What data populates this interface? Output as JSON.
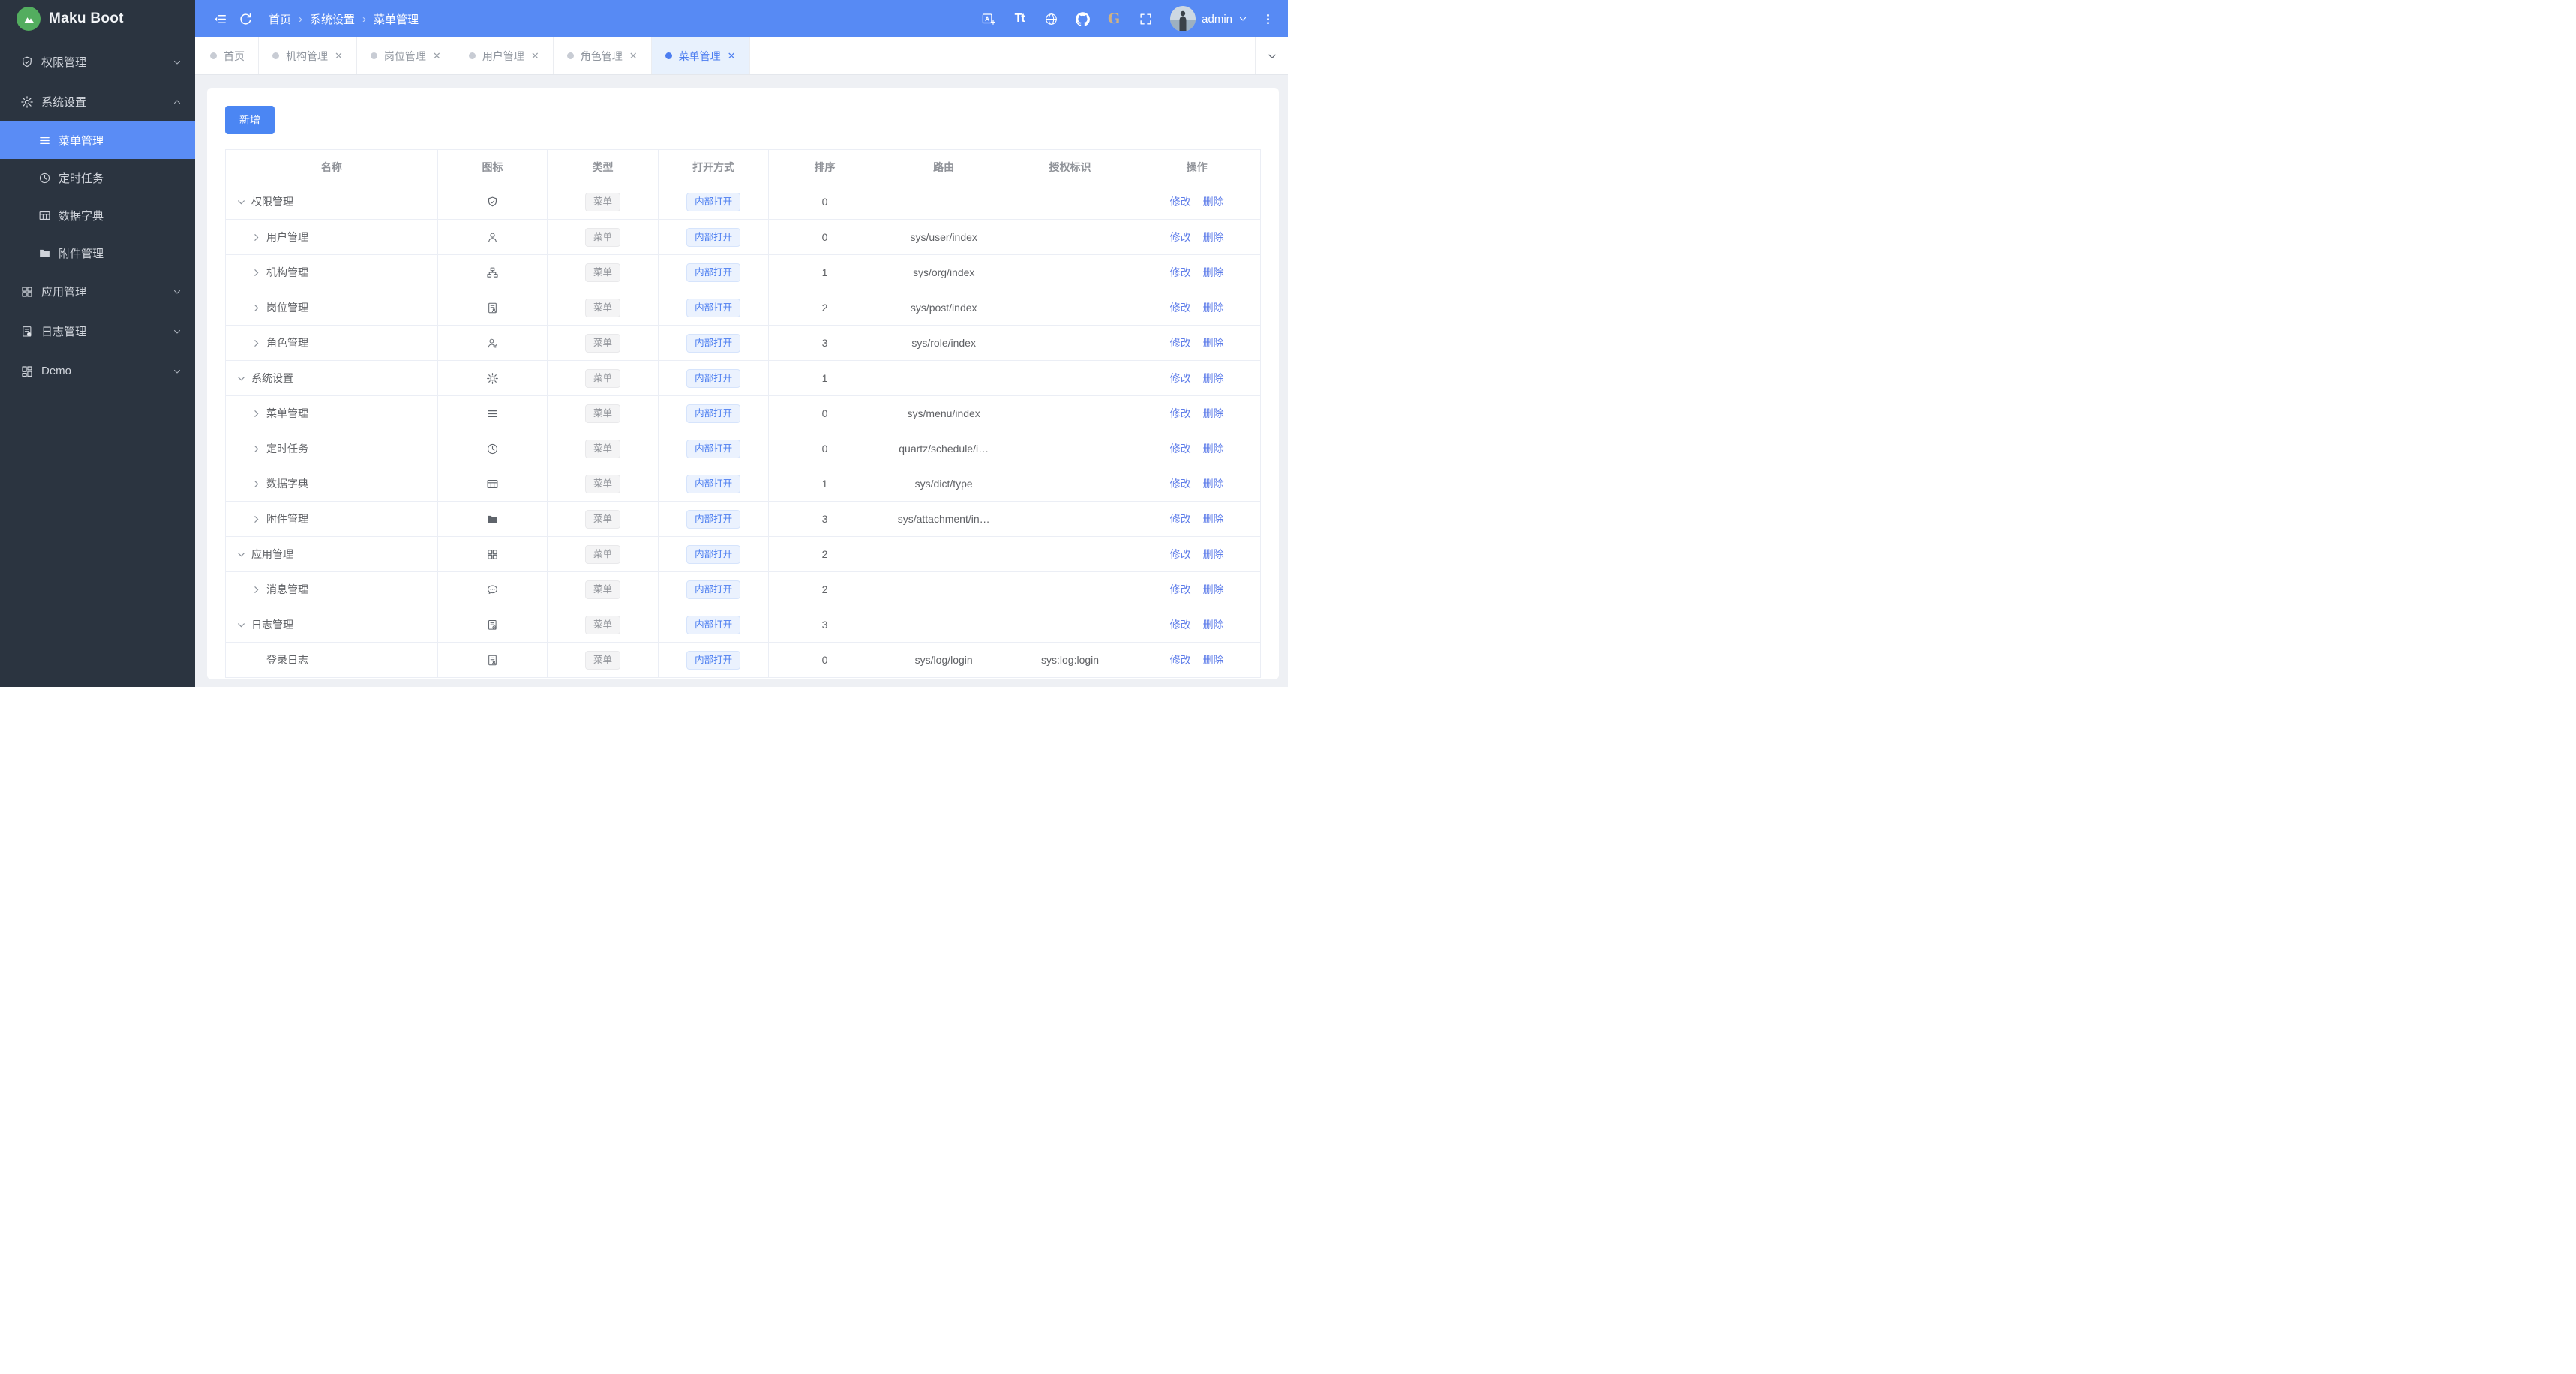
{
  "app": {
    "title": "Maku Boot"
  },
  "colors": {
    "primary": "#4c7df0",
    "header_bg": "#578af4",
    "sidebar_bg": "#2b3440",
    "sidebar_active": "#5a8cf5",
    "gitee_gold": "#cfb184"
  },
  "header": {
    "breadcrumb": [
      "首页",
      "系统设置",
      "菜单管理"
    ],
    "tool_icons": [
      "translate",
      "font-size",
      "globe",
      "github",
      "gitee",
      "fullscreen"
    ],
    "user": "admin"
  },
  "tabs": [
    {
      "label": "首页",
      "closable": false,
      "active": false
    },
    {
      "label": "机构管理",
      "closable": true,
      "active": false
    },
    {
      "label": "岗位管理",
      "closable": true,
      "active": false
    },
    {
      "label": "用户管理",
      "closable": true,
      "active": false
    },
    {
      "label": "角色管理",
      "closable": true,
      "active": false
    },
    {
      "label": "菜单管理",
      "closable": true,
      "active": true
    }
  ],
  "sidebar": {
    "items": [
      {
        "label": "权限管理",
        "icon": "shield-check",
        "expanded": false
      },
      {
        "label": "系统设置",
        "icon": "gear",
        "expanded": true,
        "children": [
          {
            "label": "菜单管理",
            "icon": "menu",
            "active": true
          },
          {
            "label": "定时任务",
            "icon": "clock",
            "active": false
          },
          {
            "label": "数据字典",
            "icon": "dict",
            "active": false
          },
          {
            "label": "附件管理",
            "icon": "folder",
            "active": false
          }
        ]
      },
      {
        "label": "应用管理",
        "icon": "grid",
        "expanded": false
      },
      {
        "label": "日志管理",
        "icon": "log",
        "expanded": false
      },
      {
        "label": "Demo",
        "icon": "grid-alt",
        "expanded": false
      }
    ]
  },
  "toolbar": {
    "add_label": "新增"
  },
  "table": {
    "columns": [
      "名称",
      "图标",
      "类型",
      "打开方式",
      "排序",
      "路由",
      "授权标识",
      "操作"
    ],
    "col_widths": [
      20.5,
      10.6,
      10.7,
      10.7,
      10.8,
      12.2,
      12.2,
      12.3
    ],
    "actions": [
      "修改",
      "删除"
    ],
    "rows": [
      {
        "name": "权限管理",
        "icon": "shield-check",
        "arrow": "down",
        "level": 0,
        "type": "菜单",
        "open": "内部打开",
        "sort": "0",
        "route": "",
        "auth": ""
      },
      {
        "name": "用户管理",
        "icon": "user",
        "arrow": "right",
        "level": 1,
        "type": "菜单",
        "open": "内部打开",
        "sort": "0",
        "route": "sys/user/index",
        "auth": ""
      },
      {
        "name": "机构管理",
        "icon": "org",
        "arrow": "right",
        "level": 1,
        "type": "菜单",
        "open": "内部打开",
        "sort": "1",
        "route": "sys/org/index",
        "auth": ""
      },
      {
        "name": "岗位管理",
        "icon": "idcard",
        "arrow": "right",
        "level": 1,
        "type": "菜单",
        "open": "内部打开",
        "sort": "2",
        "route": "sys/post/index",
        "auth": ""
      },
      {
        "name": "角色管理",
        "icon": "role",
        "arrow": "right",
        "level": 1,
        "type": "菜单",
        "open": "内部打开",
        "sort": "3",
        "route": "sys/role/index",
        "auth": ""
      },
      {
        "name": "系统设置",
        "icon": "gear",
        "arrow": "down",
        "level": 0,
        "type": "菜单",
        "open": "内部打开",
        "sort": "1",
        "route": "",
        "auth": ""
      },
      {
        "name": "菜单管理",
        "icon": "menu",
        "arrow": "right",
        "level": 1,
        "type": "菜单",
        "open": "内部打开",
        "sort": "0",
        "route": "sys/menu/index",
        "auth": ""
      },
      {
        "name": "定时任务",
        "icon": "clock",
        "arrow": "right",
        "level": 1,
        "type": "菜单",
        "open": "内部打开",
        "sort": "0",
        "route": "quartz/schedule/i…",
        "auth": ""
      },
      {
        "name": "数据字典",
        "icon": "dict",
        "arrow": "right",
        "level": 1,
        "type": "菜单",
        "open": "内部打开",
        "sort": "1",
        "route": "sys/dict/type",
        "auth": ""
      },
      {
        "name": "附件管理",
        "icon": "folder",
        "arrow": "right",
        "level": 1,
        "type": "菜单",
        "open": "内部打开",
        "sort": "3",
        "route": "sys/attachment/in…",
        "auth": ""
      },
      {
        "name": "应用管理",
        "icon": "grid",
        "arrow": "down",
        "level": 0,
        "type": "菜单",
        "open": "内部打开",
        "sort": "2",
        "route": "",
        "auth": ""
      },
      {
        "name": "消息管理",
        "icon": "message",
        "arrow": "right",
        "level": 1,
        "type": "菜单",
        "open": "内部打开",
        "sort": "2",
        "route": "",
        "auth": ""
      },
      {
        "name": "日志管理",
        "icon": "log",
        "arrow": "down",
        "level": 0,
        "type": "菜单",
        "open": "内部打开",
        "sort": "3",
        "route": "",
        "auth": ""
      },
      {
        "name": "登录日志",
        "icon": "idcard",
        "arrow": "none",
        "level": 1,
        "type": "菜单",
        "open": "内部打开",
        "sort": "0",
        "route": "sys/log/login",
        "auth": "sys:log:login"
      }
    ]
  }
}
